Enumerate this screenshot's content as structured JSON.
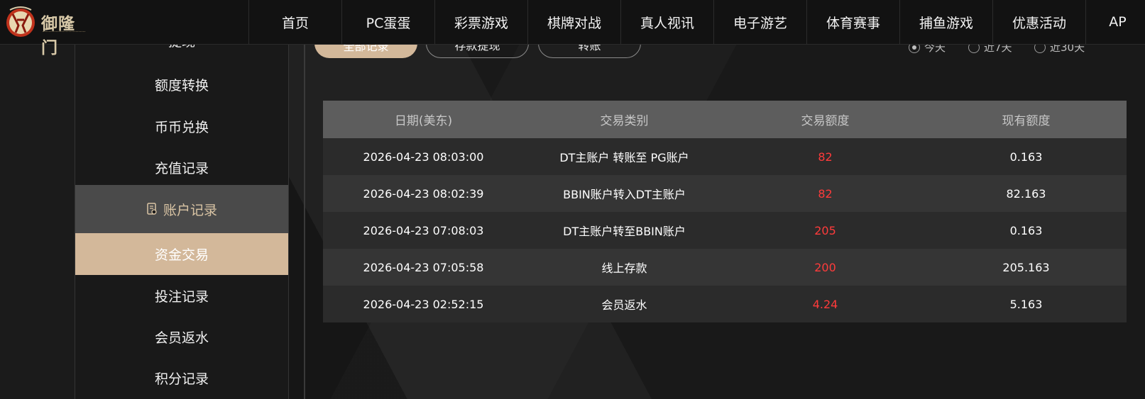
{
  "brand": {
    "name": "御隆门",
    "colors": {
      "accent": "#d3b89a",
      "amount": "#ff3b3b",
      "topbar": "#121212"
    }
  },
  "nav": {
    "items": [
      {
        "label": "首页"
      },
      {
        "label": "PC蛋蛋"
      },
      {
        "label": "彩票游戏"
      },
      {
        "label": "棋牌对战"
      },
      {
        "label": "真人视讯"
      },
      {
        "label": "电子游艺"
      },
      {
        "label": "体育赛事"
      },
      {
        "label": "捕鱼游戏"
      },
      {
        "label": "优惠活动"
      },
      {
        "label": "AP"
      }
    ]
  },
  "sidebar": {
    "items": [
      {
        "label": "提现",
        "state": "normal"
      },
      {
        "label": "额度转换",
        "state": "normal"
      },
      {
        "label": "币币兑换",
        "state": "normal"
      },
      {
        "label": "充值记录",
        "state": "normal"
      },
      {
        "label": "账户记录",
        "state": "group",
        "icon": "record-book-icon"
      },
      {
        "label": "资金交易",
        "state": "active"
      },
      {
        "label": "投注记录",
        "state": "normal"
      },
      {
        "label": "会员返水",
        "state": "normal"
      },
      {
        "label": "积分记录",
        "state": "normal"
      }
    ]
  },
  "filters": {
    "tabs": [
      {
        "label": "全部记录",
        "selected": true
      },
      {
        "label": "存款提现",
        "selected": false
      },
      {
        "label": "转账",
        "selected": false
      }
    ],
    "ranges": [
      {
        "label": "今天",
        "selected": true
      },
      {
        "label": "近7天",
        "selected": false
      },
      {
        "label": "近30天",
        "selected": false
      }
    ]
  },
  "table": {
    "headers": [
      "日期(美东)",
      "交易类别",
      "交易额度",
      "现有额度"
    ],
    "rows": [
      {
        "date": "2026-04-23 08:03:00",
        "type": "DT主账户 转账至 PG账户",
        "amount": "82",
        "balance": "0.163"
      },
      {
        "date": "2026-04-23 08:02:39",
        "type": "BBIN账户转入DT主账户",
        "amount": "82",
        "balance": "82.163"
      },
      {
        "date": "2026-04-23 07:08:03",
        "type": "DT主账户转至BBIN账户",
        "amount": "205",
        "balance": "0.163"
      },
      {
        "date": "2026-04-23 07:05:58",
        "type": "线上存款",
        "amount": "200",
        "balance": "205.163"
      },
      {
        "date": "2026-04-23 02:52:15",
        "type": "会员返水",
        "amount": "4.24",
        "balance": "5.163"
      }
    ]
  }
}
